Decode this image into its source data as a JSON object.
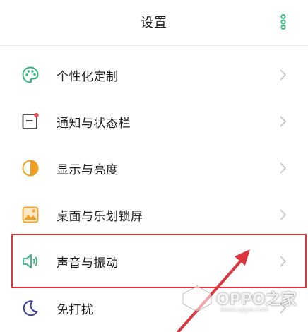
{
  "header": {
    "title": "设置"
  },
  "items": [
    {
      "label": "个性化定制",
      "icon": "palette-icon"
    },
    {
      "label": "通知与状态栏",
      "icon": "notification-icon"
    },
    {
      "label": "显示与亮度",
      "icon": "brightness-icon"
    },
    {
      "label": "桌面与乐划锁屏",
      "icon": "wallpaper-icon"
    },
    {
      "label": "声音与振动",
      "icon": "speaker-icon"
    },
    {
      "label": "免打扰",
      "icon": "moon-icon"
    }
  ],
  "watermark": {
    "text": "OPPO之家",
    "url": "www.oppo.com"
  },
  "colors": {
    "accent_green": "#2fb57a",
    "highlight_red": "#d9363e",
    "icon_orange": "#f0a020",
    "icon_red": "#e05050"
  }
}
